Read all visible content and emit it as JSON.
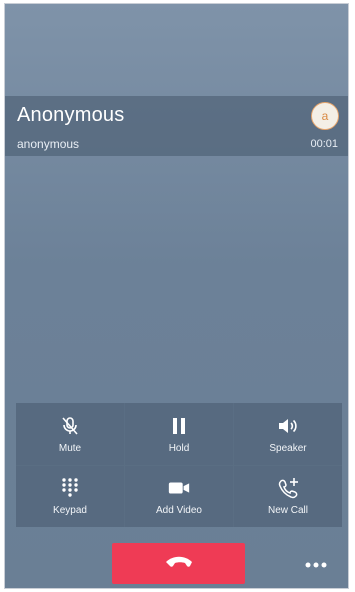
{
  "caller": {
    "name": "Anonymous",
    "subtitle": "anonymous",
    "duration": "00:01",
    "avatar_initial": "a"
  },
  "controls": [
    {
      "label": "Mute",
      "icon": "microphone-muted-icon"
    },
    {
      "label": "Hold",
      "icon": "pause-icon"
    },
    {
      "label": "Speaker",
      "icon": "speaker-icon"
    },
    {
      "label": "Keypad",
      "icon": "keypad-icon"
    },
    {
      "label": "Add Video",
      "icon": "video-camera-icon"
    },
    {
      "label": "New Call",
      "icon": "phone-plus-icon"
    }
  ],
  "end_call": {
    "icon": "end-call-icon",
    "color": "#ef3b55"
  },
  "more": {
    "icon": "more-icon",
    "label": "•••"
  }
}
